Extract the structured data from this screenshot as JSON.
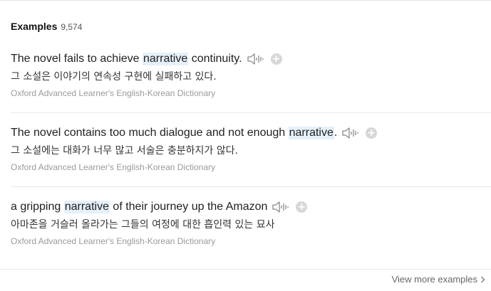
{
  "header": {
    "title": "Examples",
    "count": "9,574"
  },
  "examples": [
    {
      "before": "The novel fails to achieve ",
      "keyword": "narrative",
      "after": " continuity.",
      "translation": "그 소설은 이야기의 연속성 구현에 실패하고 있다.",
      "source": "Oxford Advanced Learner's English-Korean Dictionary"
    },
    {
      "before": "The novel contains too much dialogue and not enough ",
      "keyword": "narrative",
      "after": ".",
      "translation": "그 소설에는 대화가 너무 많고 서술은 충분하지가 않다.",
      "source": "Oxford Advanced Learner's English-Korean Dictionary"
    },
    {
      "before": "a gripping ",
      "keyword": "narrative",
      "after": " of their journey up the Amazon",
      "translation": "아마존을 거슬러 올라가는 그들의 여정에 대한 흡인력 있는 묘사",
      "source": "Oxford Advanced Learner's English-Korean Dictionary"
    }
  ],
  "icons": {
    "sound": "speaker-icon",
    "add": "plus-icon",
    "more": "chevron-right-icon"
  },
  "colors": {
    "highlight": "#e6f0fa",
    "icon": "#8a8a8a",
    "add_button": "#d7d7d7"
  },
  "footer": {
    "more_label": "View more examples"
  }
}
